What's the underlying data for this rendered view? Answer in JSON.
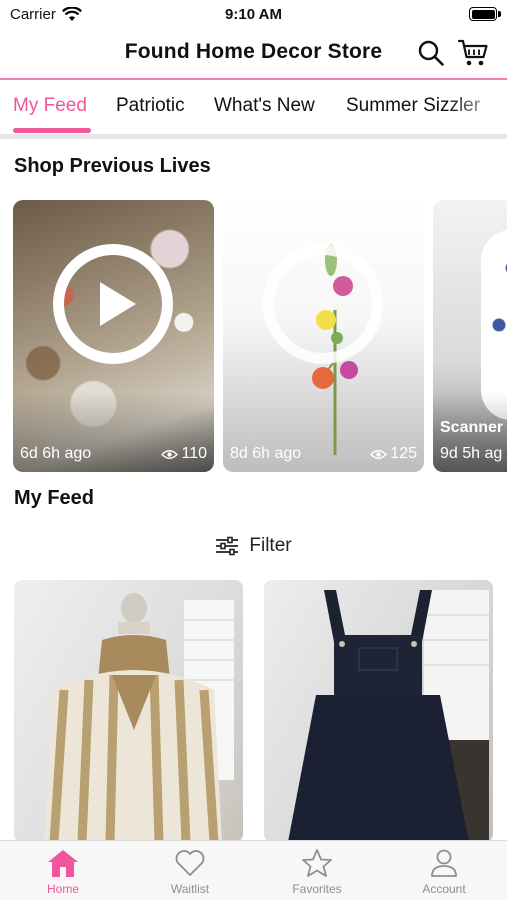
{
  "status_bar": {
    "carrier": "Carrier",
    "time": "9:10 AM"
  },
  "header": {
    "title": "Found Home Decor Store",
    "search_icon": "search-icon",
    "cart_icon": "cart-icon"
  },
  "colors": {
    "accent": "#f2559b",
    "rule": "#f27fb5",
    "inactive": "#8e8e93"
  },
  "tabs": [
    {
      "label": "My Feed",
      "active": true
    },
    {
      "label": "Patriotic",
      "active": false
    },
    {
      "label": "What's New",
      "active": false
    },
    {
      "label": "Summer Sizzler",
      "active": false
    }
  ],
  "lives_section": {
    "heading": "Shop Previous Lives",
    "cards": [
      {
        "ago": "6d 6h ago",
        "views": "110",
        "name": ""
      },
      {
        "ago": "8d 6h ago",
        "views": "125",
        "name": ""
      },
      {
        "ago": "9d 5h ag",
        "views": "",
        "name": "Scanner"
      }
    ]
  },
  "feed_section": {
    "heading": "My Feed",
    "filter_label": "Filter"
  },
  "bottom_nav": [
    {
      "label": "Home",
      "icon": "home-icon",
      "active": true
    },
    {
      "label": "Waitlist",
      "icon": "heart-icon",
      "active": false
    },
    {
      "label": "Favorites",
      "icon": "star-icon",
      "active": false
    },
    {
      "label": "Account",
      "icon": "person-icon",
      "active": false
    }
  ]
}
